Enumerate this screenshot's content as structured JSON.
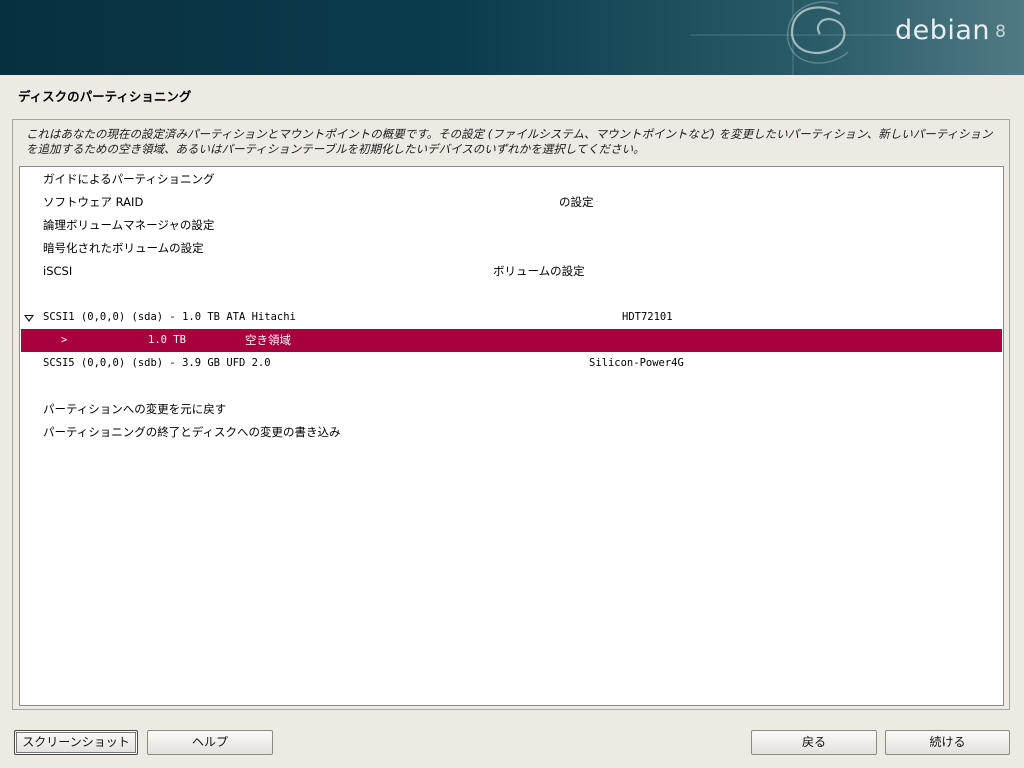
{
  "header": {
    "logo_text": "debian",
    "logo_version": "8"
  },
  "page_title": "ディスクのパーティショニング",
  "description": "これはあなたの現在の設定済みパーティションとマウントポイントの概要です。その設定 (ファイルシステム、マウントポイントなど) を変更したいパーティション、新しいパーティションを追加するための空き領域、あるいはパーティションテーブルを初期化したいデバイスのいずれかを選択してください。",
  "list": {
    "items": [
      {
        "label": "ガイドによるパーティショニング",
        "extra": ""
      },
      {
        "label": "ソフトウェア RAID",
        "extra": "の設定"
      },
      {
        "label": "論理ボリュームマネージャの設定",
        "extra": ""
      },
      {
        "label": "暗号化されたボリュームの設定",
        "extra": ""
      },
      {
        "label": "iSCSI",
        "extra": "ボリュームの設定"
      }
    ],
    "disk1": {
      "label": "SCSI1 (0,0,0) (sda) - 1.0 TB ATA Hitachi",
      "model": "HDT72101"
    },
    "free_space": {
      "marker": ">",
      "size": "1.0 TB",
      "label": "空き領域"
    },
    "disk2": {
      "label": "SCSI5 (0,0,0) (sdb) - 3.9 GB UFD 2.0",
      "model": "Silicon-Power4G"
    },
    "actions": [
      {
        "label": "パーティションへの変更を元に戻す"
      },
      {
        "label": "パーティショニングの終了とディスクへの変更の書き込み"
      }
    ]
  },
  "buttons": {
    "screenshot": "スクリーンショット",
    "help": "ヘルプ",
    "back": "戻る",
    "continue": "続ける"
  },
  "colors": {
    "selection": "#a8003f",
    "banner": "#0b3c4c"
  }
}
